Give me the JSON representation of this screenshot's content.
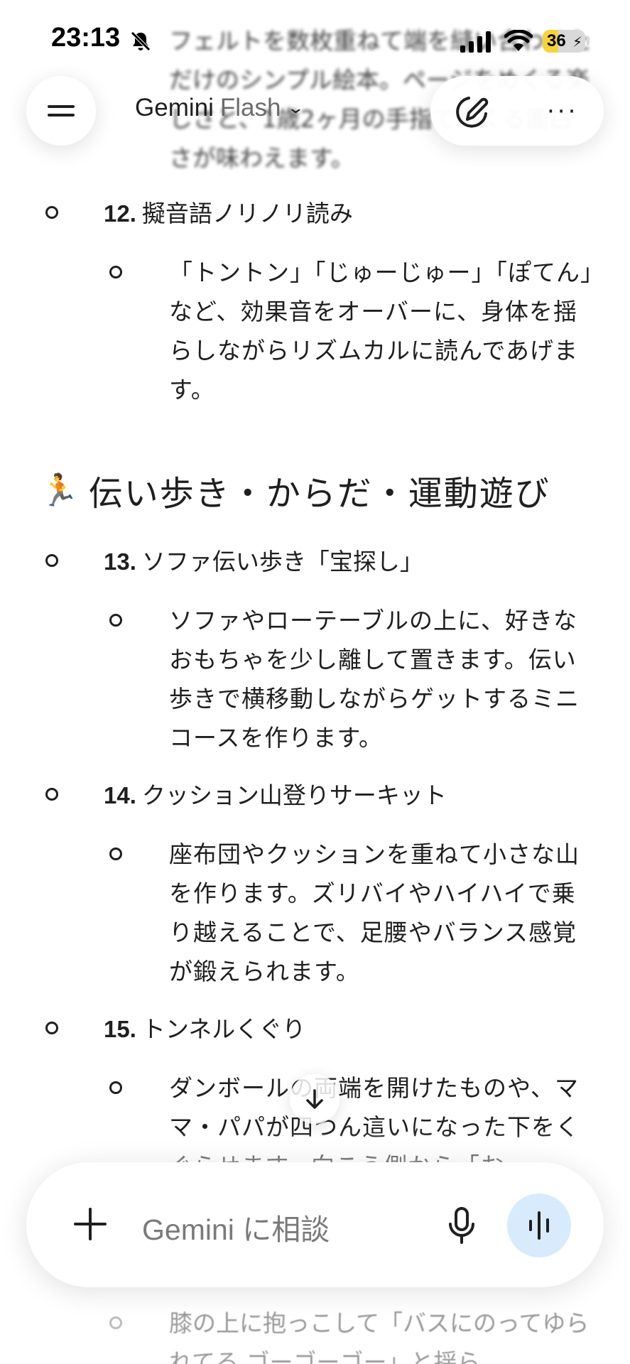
{
  "status_bar": {
    "time": "23:13",
    "battery": "36",
    "battery_fraction": 0.36,
    "icons": [
      "bell-off-icon",
      "signal-icon",
      "wifi-icon",
      "battery-icon"
    ]
  },
  "header": {
    "model_name": "Gemini",
    "model_variant": "Flash",
    "icons": [
      "menu-icon",
      "chevron-down-icon",
      "new-chat-icon",
      "more-icon"
    ]
  },
  "content": {
    "top_partial": "フェルトを数枚重ねて端を縫い合わせただけのシンプル絵本。ページをめくる楽しさと、1歳2ヶ月の手指でめくる面白さが味わえます。",
    "items_a": [
      {
        "number": "12.",
        "title": "擬音語ノリノリ読み",
        "desc": "「トントン」「じゅーじゅー」「ぽてん」など、効果音をオーバーに、身体を揺らしながらリズムカルに読んであげます。"
      }
    ],
    "section": {
      "emoji": "🏃",
      "title": "伝い歩き・からだ・運動遊び"
    },
    "items_b": [
      {
        "number": "13.",
        "title": "ソファ伝い歩き「宝探し」",
        "desc": "ソファやローテーブルの上に、好きなおもちゃを少し離して置きます。伝い歩きで横移動しながらゲットするミニコースを作ります。"
      },
      {
        "number": "14.",
        "title": "クッション山登りサーキット",
        "desc": "座布団やクッションを重ねて小さな山を作ります。ズリバイやハイハイで乗り越えることで、足腰やバランス感覚が鍛えられます。"
      },
      {
        "number": "15.",
        "title": "トンネルくぐり",
        "desc": "ダンボールの両端を開けたものや、ママ・パパが四つん這いになった下をくぐらせます。向こう側から「お"
      }
    ],
    "bottom_partial": "膝の上に抱っこして「バスにのってゆられてる ゴーゴーゴー」と揺ら"
  },
  "input": {
    "placeholder": "Gemini に相談",
    "icons": [
      "plus-icon",
      "mic-icon",
      "live-icon",
      "arrow-down-icon"
    ]
  }
}
